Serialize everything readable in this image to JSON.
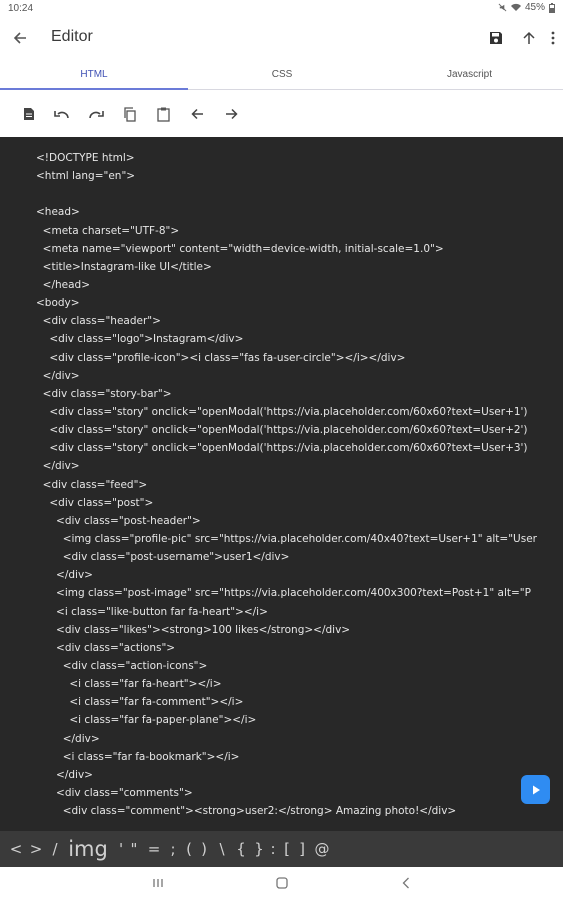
{
  "status_bar": {
    "time": "10:24",
    "battery": "45%"
  },
  "app_bar": {
    "title": "Editor"
  },
  "tabs": [
    {
      "label": "HTML"
    },
    {
      "label": "CSS"
    },
    {
      "label": "Javascript"
    }
  ],
  "code_lines": [
    "<!DOCTYPE html>",
    "<html lang=\"en\">",
    "",
    "<head>",
    "  <meta charset=\"UTF-8\">",
    "  <meta name=\"viewport\" content=\"width=device-width, initial-scale=1.0\">",
    "  <title>Instagram-like UI</title>",
    "  </head>",
    "<body>",
    "  <div class=\"header\">",
    "    <div class=\"logo\">Instagram</div>",
    "    <div class=\"profile-icon\"><i class=\"fas fa-user-circle\"></i></div>",
    "  </div>",
    "  <div class=\"story-bar\">",
    "    <div class=\"story\" onclick=\"openModal('https://via.placeholder.com/60x60?text=User+1')",
    "    <div class=\"story\" onclick=\"openModal('https://via.placeholder.com/60x60?text=User+2')",
    "    <div class=\"story\" onclick=\"openModal('https://via.placeholder.com/60x60?text=User+3')",
    "  </div>",
    "  <div class=\"feed\">",
    "    <div class=\"post\">",
    "      <div class=\"post-header\">",
    "        <img class=\"profile-pic\" src=\"https://via.placeholder.com/40x40?text=User+1\" alt=\"User",
    "        <div class=\"post-username\">user1</div>",
    "      </div>",
    "      <img class=\"post-image\" src=\"https://via.placeholder.com/400x300?text=Post+1\" alt=\"P",
    "      <i class=\"like-button far fa-heart\"></i>",
    "      <div class=\"likes\"><strong>100 likes</strong></div>",
    "      <div class=\"actions\">",
    "        <div class=\"action-icons\">",
    "          <i class=\"far fa-heart\"></i>",
    "          <i class=\"far fa-comment\"></i>",
    "          <i class=\"far fa-paper-plane\"></i>",
    "        </div>",
    "        <i class=\"far fa-bookmark\"></i>",
    "      </div>",
    "      <div class=\"comments\">",
    "        <div class=\"comment\"><strong>user2:</strong> Amazing photo!</div>"
  ],
  "symbols": [
    "<",
    ">",
    "/",
    "img",
    "'",
    "\"",
    "=",
    ";",
    "(",
    ")",
    "\\",
    "{",
    "}",
    ":",
    "[",
    "]",
    "@"
  ],
  "icons": {
    "back": "arrow-left-icon",
    "save": "save-icon",
    "upload": "arrow-up-icon",
    "more": "more-vert-icon",
    "file": "file-icon",
    "undo": "undo-icon",
    "redo": "redo-icon",
    "copy": "copy-icon",
    "paste": "paste-icon",
    "prev": "arrow-left-icon",
    "next": "arrow-right-icon",
    "run": "play-icon"
  },
  "colors": {
    "accent": "#3f51b5",
    "editor_bg": "#282828",
    "fab": "#2f8cf2",
    "symbol_bar": "#3a3a3a"
  }
}
